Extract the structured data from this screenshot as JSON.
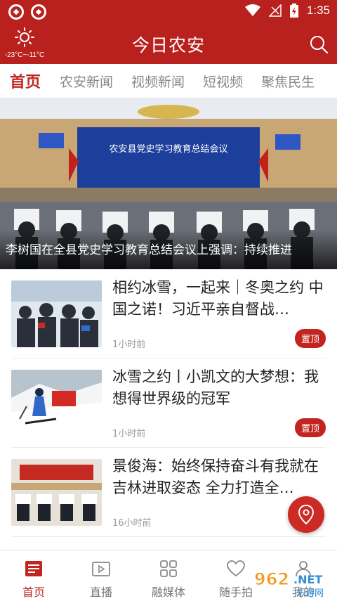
{
  "status_bar": {
    "time": "1:35"
  },
  "header": {
    "weather": "-23°C~-11°C",
    "title": "今日农安"
  },
  "tabs": [
    "首页",
    "农安新闻",
    "视频新闻",
    "短视频",
    "聚焦民生"
  ],
  "hero": {
    "banner_text": "农安县党史学习教育总结会议",
    "caption": "李树国在全县党史学习教育总结会议上强调：持续推进"
  },
  "news": [
    {
      "title": "相约冰雪，一起来｜冬奥之约 中国之诺！习近平亲自督战…",
      "time": "1小时前",
      "pin_label": "置顶"
    },
    {
      "title": "冰雪之约丨小凯文的大梦想：我想得世界级的冠军",
      "time": "1小时前",
      "pin_label": "置顶"
    },
    {
      "title": "景俊海：始终保持奋斗有我就在吉林进取姿态 全力打造全…",
      "time": "16小时前"
    }
  ],
  "bottom_nav": [
    {
      "label": "首页",
      "icon": "news-icon"
    },
    {
      "label": "直播",
      "icon": "live-icon"
    },
    {
      "label": "融媒体",
      "icon": "grid-icon"
    },
    {
      "label": "随手拍",
      "icon": "heart-icon"
    },
    {
      "label": "我的",
      "icon": "user-icon"
    }
  ],
  "watermark": {
    "brand": "962.NET",
    "sub": "乐游网"
  },
  "colors": {
    "primary": "#b8211d",
    "accent": "#c22520"
  }
}
